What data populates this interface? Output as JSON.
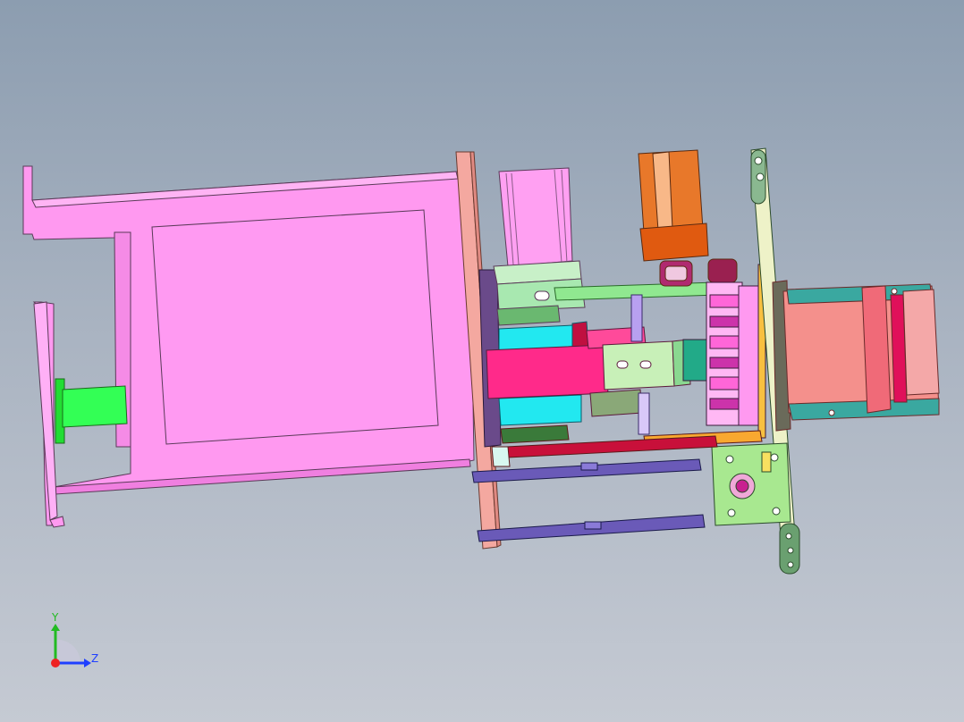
{
  "viewport": {
    "background_top": "#8c9db0",
    "background_bottom": "#c5cad3"
  },
  "axis_triad": {
    "y_label": "Y",
    "z_label": "Z",
    "y_color": "#22bb22",
    "z_color": "#1f3fff",
    "origin_color": "#ee2222"
  },
  "model": {
    "parts": [
      "main-frame",
      "inner-panel",
      "green-coupler",
      "side-bracket",
      "end-plate",
      "stepper-motor-top",
      "dc-motor",
      "pink-carriage",
      "cyan-block",
      "guide-rod",
      "roller-assembly",
      "right-motor",
      "gear-plate",
      "long-link",
      "lower-rod-1",
      "lower-rod-2"
    ],
    "colors": {
      "frame": "#ff99f0",
      "coupler": "#22ee44",
      "plate": "#f4a8a0",
      "carriage": "#ff2a8a",
      "cyan": "#22e8f0",
      "motor_copper": "#e8782a",
      "motor_orange": "#e05a10",
      "green_plate": "#a8e890",
      "rod_purple": "#6a5ab8",
      "salmon_motor": "#f4908c"
    }
  }
}
